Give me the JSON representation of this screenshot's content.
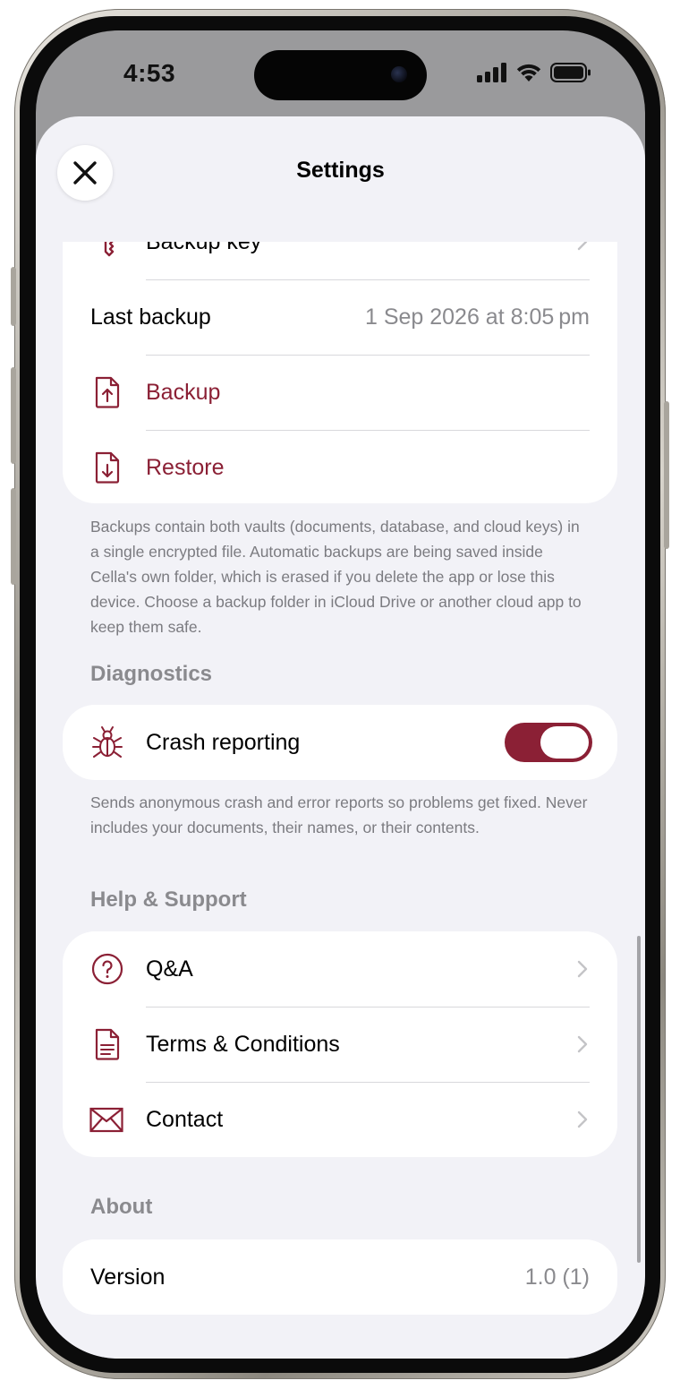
{
  "status_bar": {
    "time": "4:53"
  },
  "nav": {
    "title": "Settings",
    "close_icon": "close-icon"
  },
  "colors": {
    "accent": "#8b2035",
    "sheet_bg": "#f2f2f7",
    "secondary_text": "#8a8a8e"
  },
  "backup_section": {
    "rows": [
      {
        "label": "Backup key",
        "icon": "key-icon"
      },
      {
        "label": "Last backup",
        "value": "1 Sep 2026 at 8:05 pm"
      },
      {
        "label": "Backup",
        "icon": "upload-document-icon"
      },
      {
        "label": "Restore",
        "icon": "download-document-icon"
      }
    ],
    "footnote": "Backups contain both vaults (documents, database, and cloud keys) in a single encrypted file. Automatic backups are being saved inside Cella's own folder, which is erased if you delete the app or lose this device. Choose a backup folder in iCloud Drive or another cloud app to keep them safe."
  },
  "diagnostics_section": {
    "header": "Diagnostics",
    "crash_reporting": {
      "label": "Crash reporting",
      "icon": "bug-icon",
      "enabled": true
    },
    "footnote": "Sends anonymous crash and error reports so problems get fixed. Never includes your documents, their names, or their contents."
  },
  "help_section": {
    "header": "Help & Support",
    "rows": [
      {
        "label": "Q&A",
        "icon": "question-circle-icon"
      },
      {
        "label": "Terms & Conditions",
        "icon": "document-icon"
      },
      {
        "label": "Contact",
        "icon": "envelope-icon"
      }
    ]
  },
  "about_section": {
    "header": "About",
    "version": {
      "label": "Version",
      "value": "1.0 (1)"
    }
  }
}
